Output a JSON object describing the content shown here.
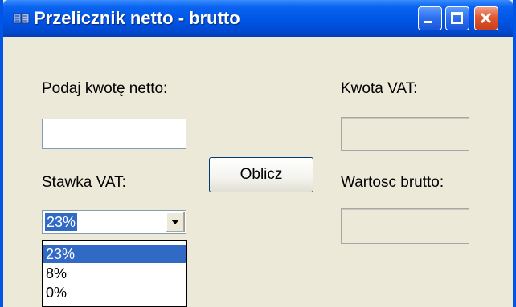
{
  "window": {
    "title": "Przelicznik netto - brutto",
    "colors": {
      "titlebar": "#0055E5",
      "close_button": "#E0582E",
      "selection": "#316AC5",
      "face": "#ECE9D8"
    },
    "icons": {
      "app": "app-icon",
      "minimize": "minimize-icon",
      "maximize": "maximize-icon",
      "close": "close-icon",
      "dropdown": "chevron-down-icon"
    }
  },
  "form": {
    "netto_label": "Podaj kwotę netto:",
    "netto_value": "",
    "vat_rate_label": "Stawka VAT:",
    "vat_rate_selected": "23%",
    "vat_rate_options": [
      "23%",
      "8%",
      "0%"
    ],
    "calculate_label": "Oblicz",
    "vat_amount_label": "Kwota VAT:",
    "vat_amount_value": "",
    "brutto_label": "Wartosc brutto:",
    "brutto_value": ""
  }
}
